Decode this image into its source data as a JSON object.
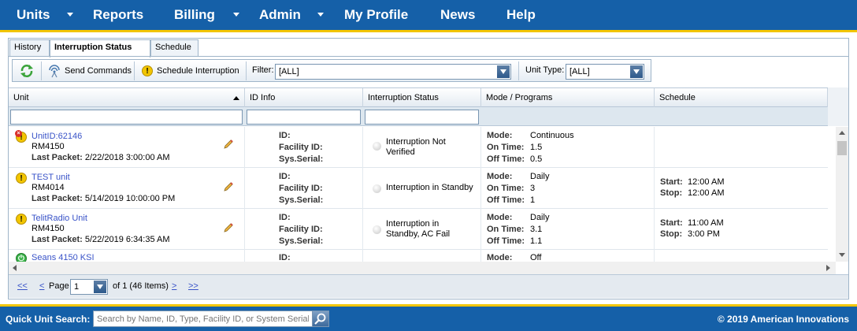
{
  "nav": {
    "units": "Units",
    "reports": "Reports",
    "billing": "Billing",
    "admin": "Admin",
    "my_profile": "My Profile",
    "news": "News",
    "help": "Help"
  },
  "tabs": [
    "History",
    "Interruption Status",
    "Schedule"
  ],
  "active_tab": "Interruption Status",
  "toolbar": {
    "refresh_icon": "refresh-icon",
    "send_commands": "Send Commands",
    "schedule_interruption": "Schedule Interruption",
    "filter_label": "Filter:",
    "filter_value": "[ALL]",
    "unit_type_label": "Unit Type:",
    "unit_type_value": "[ALL]"
  },
  "columns": {
    "unit": "Unit",
    "id_info": "ID Info",
    "interruption_status": "Interruption Status",
    "mode_programs": "Mode / Programs",
    "schedule": "Schedule"
  },
  "labels": {
    "last_packet": "Last Packet:",
    "id": "ID:",
    "facility_id": "Facility ID:",
    "sys_serial": "Sys.Serial:",
    "mode": "Mode:",
    "on_time": "On Time:",
    "off_time": "Off Time:",
    "start": "Start:",
    "stop": "Stop:"
  },
  "rows": [
    {
      "unit": "UnitID:62146",
      "model": "RM4150",
      "last_packet": "2/22/2018 3:00:00 AM",
      "status_icon": "alert-red",
      "interruption_status": "Interruption Not Verified",
      "mode": "Continuous",
      "on_time": "1.5",
      "off_time": "0.5",
      "start": "",
      "stop": ""
    },
    {
      "unit": "TEST unit",
      "model": "RM4014",
      "last_packet": "5/14/2019 10:00:00 PM",
      "status_icon": "alert-yellow",
      "interruption_status": "Interruption in Standby",
      "mode": "Daily",
      "on_time": "3",
      "off_time": "1",
      "start": "12:00 AM",
      "stop": "12:00 AM"
    },
    {
      "unit": "TelitRadio Unit",
      "model": "RM4150",
      "last_packet": "5/22/2019 6:34:35 AM",
      "status_icon": "alert-yellow",
      "interruption_status": "Interruption in Standby, AC Fail",
      "mode": "Daily",
      "on_time": "3.1",
      "off_time": "1.1",
      "start": "11:00 AM",
      "stop": "3:00 PM"
    },
    {
      "unit": "Seans 4150 KSI",
      "model": "",
      "last_packet": "",
      "status_icon": "ok-green",
      "interruption_status": "",
      "mode": "Off",
      "on_time": "",
      "off_time": "",
      "start": "",
      "stop": ""
    }
  ],
  "pager": {
    "first": "<<",
    "prev": "<",
    "page_label": "Page",
    "page_value": "1",
    "of_text": "of 1 (46 Items)",
    "next": ">",
    "last": ">>"
  },
  "footer": {
    "quick_search_label": "Quick Unit Search:",
    "quick_search_placeholder": "Search by Name, ID, Type, Facility ID, or System Serial",
    "copyright": "© 2019 American Innovations"
  },
  "colors": {
    "nav_blue": "#1560a8",
    "stripe_yellow": "#f2c500",
    "link_blue": "#3953c8"
  }
}
